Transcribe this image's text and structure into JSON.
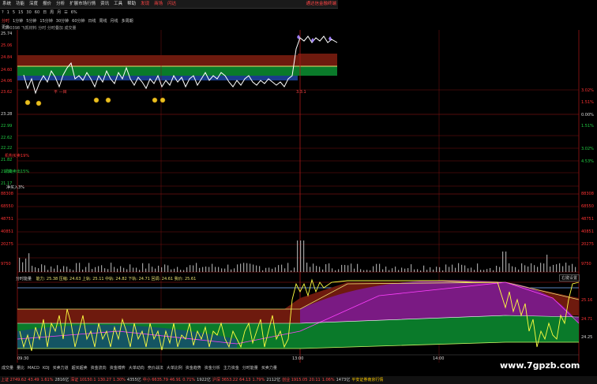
{
  "menu": {
    "items": [
      "系统",
      "功能",
      "深度",
      "报价",
      "分析",
      "扩展市场行情",
      "资讯",
      "工具",
      "帮助"
    ],
    "highlight_items": [
      "发现",
      "商场",
      "闪达"
    ],
    "right_text": "通达信金融终端"
  },
  "period_tabs": {
    "items": [
      "分时",
      "1分钟",
      "5分钟",
      "15分钟",
      "30分钟",
      "60分钟",
      "日线",
      "周线",
      "月线",
      "多周期",
      "更多"
    ],
    "active": 0
  },
  "toolbar": {
    "buttons": [
      "?",
      "1",
      "5",
      "15",
      "30",
      "60",
      "日",
      "周",
      "月",
      "☰"
    ],
    "percent": "6%"
  },
  "subtitle": "300398 飞凯材料  分时 分时叠加  成交量",
  "price_axis_left": {
    "upper": [
      "25.74",
      "25.06",
      "24.84",
      "24.60",
      "24.06",
      "23.62"
    ],
    "lower": [
      "23.28",
      "22.99",
      "22.62",
      "22.22",
      "21.82",
      "21.52",
      "21.17"
    ],
    "labels": [
      "机构买卖19%",
      "机构卖出15%",
      "净买入3%"
    ]
  },
  "price_axis_right": {
    "values": [
      "3.02%",
      "1.51%",
      "0.00%",
      "1.51%",
      "3.02%",
      "4.53%"
    ]
  },
  "volume_axis_left": [
    "88308",
    "68550",
    "48751",
    "40851",
    "20275",
    "9750"
  ],
  "volume_axis_right": [
    "88308",
    "68550",
    "48751",
    "40851",
    "20275",
    "9750"
  ],
  "mid_marker": "3.3.1",
  "indicator": {
    "name": "分时能量",
    "label_text": "能力: 25.38  压缩: 24.63  上轨: 25.11  中轨: 24.82  下轨: 24.71  回调: 24.61  我价: 25.61",
    "right_button": "右键设置",
    "right_axis": [
      "25.16",
      "24.71",
      "24.25"
    ],
    "time_labels": [
      "09:30",
      "13:00",
      "14:00"
    ]
  },
  "bottom_tabs": [
    "成交量",
    "量比",
    "MACD",
    "KDJ",
    "买卖力道",
    "超买超卖",
    "资金流向",
    "资金博弈",
    "大单动向",
    "竞价战法",
    "大单比例",
    "资金趋势",
    "资金分析",
    "主力资金",
    "分时能量",
    "买卖力量"
  ],
  "status": {
    "items": [
      {
        "text": "上证 2749.62",
        "cls": "r"
      },
      {
        "text": "43.49",
        "cls": "r"
      },
      {
        "text": "1.61%",
        "cls": "r"
      },
      {
        "text": "2816亿",
        "cls": ""
      },
      {
        "text": "深证 10150.1",
        "cls": "r"
      },
      {
        "text": "130.27",
        "cls": "r"
      },
      {
        "text": "1.30%",
        "cls": "r"
      },
      {
        "text": "4355亿",
        "cls": ""
      },
      {
        "text": "中小 6635.79",
        "cls": "r"
      },
      {
        "text": "46.91",
        "cls": "r"
      },
      {
        "text": "0.71%",
        "cls": "r"
      },
      {
        "text": "1922亿",
        "cls": ""
      },
      {
        "text": "沪深 3653.22",
        "cls": "r"
      },
      {
        "text": "64.13",
        "cls": "r"
      },
      {
        "text": "1.79%",
        "cls": "r"
      },
      {
        "text": "2112亿",
        "cls": ""
      },
      {
        "text": "创业 1915.05",
        "cls": "r"
      },
      {
        "text": "20.11",
        "cls": "r"
      },
      {
        "text": "1.06%",
        "cls": "r"
      },
      {
        "text": "1473亿",
        "cls": ""
      },
      {
        "text": "平安证券南京行情",
        "cls": "y"
      }
    ]
  },
  "watermark": "www.7gpzb.com",
  "colors": {
    "red_band": "#6e1a0e",
    "yellow_line": "#e8e070",
    "green_band": "#0a7a2a",
    "blue_band": "#1a3c8a",
    "purple_band": "#7a1a8a",
    "gridline": "#7a1010",
    "price_line": "#ffffff",
    "volume_bar": "#a0a0a0"
  }
}
